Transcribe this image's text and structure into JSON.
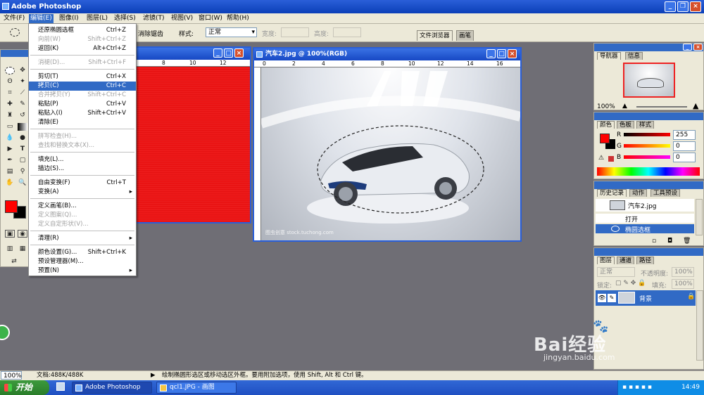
{
  "app": {
    "title": "Adobe Photoshop"
  },
  "menubar": [
    "文件(F)",
    "编辑(E)",
    "图像(I)",
    "图层(L)",
    "选择(S)",
    "滤镜(T)",
    "视图(V)",
    "窗口(W)",
    "帮助(H)"
  ],
  "options": {
    "feather_tail": "消除锯齿",
    "style_label": "样式:",
    "style_value": "正常",
    "width_label": "宽度:",
    "height_label": "高度:",
    "tab_file_browser": "文件浏览器",
    "tab_brushes": "画笔"
  },
  "edit_menu": {
    "items": [
      {
        "label": "还原椭圆选框",
        "shortcut": "Ctrl+Z",
        "disabled": false
      },
      {
        "label": "向前(W)",
        "shortcut": "Shift+Ctrl+Z",
        "disabled": true
      },
      {
        "label": "返回(K)",
        "shortcut": "Alt+Ctrl+Z",
        "disabled": false
      },
      {
        "label": "消褪(D)...",
        "shortcut": "Shift+Ctrl+F",
        "disabled": true
      },
      {
        "label": "剪切(T)",
        "shortcut": "Ctrl+X",
        "disabled": false
      },
      {
        "label": "拷贝(C)",
        "shortcut": "Ctrl+C",
        "disabled": false,
        "highlight": true
      },
      {
        "label": "合并拷贝(Y)",
        "shortcut": "Shift+Ctrl+C",
        "disabled": true
      },
      {
        "label": "粘贴(P)",
        "shortcut": "Ctrl+V",
        "disabled": false
      },
      {
        "label": "粘贴入(I)",
        "shortcut": "Shift+Ctrl+V",
        "disabled": false
      },
      {
        "label": "清除(E)",
        "shortcut": "",
        "disabled": false
      },
      {
        "label": "拼写检查(H)...",
        "shortcut": "",
        "disabled": true
      },
      {
        "label": "查找和替换文本(X)...",
        "shortcut": "",
        "disabled": true
      },
      {
        "label": "填充(L)...",
        "shortcut": "",
        "disabled": false
      },
      {
        "label": "描边(S)...",
        "shortcut": "",
        "disabled": false
      },
      {
        "label": "自由变换(F)",
        "shortcut": "Ctrl+T",
        "disabled": false
      },
      {
        "label": "变换(A)",
        "shortcut": "",
        "disabled": false,
        "submenu": true
      },
      {
        "label": "定义画笔(B)...",
        "shortcut": "",
        "disabled": false
      },
      {
        "label": "定义图案(Q)...",
        "shortcut": "",
        "disabled": true
      },
      {
        "label": "定义自定形状(V)...",
        "shortcut": "",
        "disabled": true
      },
      {
        "label": "清理(R)",
        "shortcut": "",
        "disabled": false,
        "submenu": true
      },
      {
        "label": "颜色设置(G)...",
        "shortcut": "Shift+Ctrl+K",
        "disabled": false
      },
      {
        "label": "预设管理器(M)...",
        "shortcut": "",
        "disabled": false
      },
      {
        "label": "预置(N)",
        "shortcut": "",
        "disabled": false,
        "submenu": true
      }
    ]
  },
  "doc_window": {
    "title": "汽车2.jpg @ 100%(RGB)",
    "ruler_labels": [
      "0",
      "2",
      "4",
      "6",
      "8",
      "10",
      "12",
      "14",
      "16"
    ],
    "watermark": "图虫创意 stock.tuchong.com"
  },
  "bg_window": {
    "ruler_labels": [
      "8",
      "10",
      "12"
    ]
  },
  "navigator": {
    "tabs": [
      "导航器",
      "信息"
    ],
    "zoom": "100%"
  },
  "color_panel": {
    "tabs": [
      "颜色",
      "色板",
      "样式"
    ],
    "channels": [
      {
        "name": "R",
        "value": "255"
      },
      {
        "name": "G",
        "value": "0"
      },
      {
        "name": "B",
        "value": "0"
      }
    ]
  },
  "history": {
    "tabs": [
      "历史记录",
      "动作",
      "工具预设"
    ],
    "snapshot": "汽车2.jpg",
    "steps": [
      "打开",
      "椭圆选框"
    ]
  },
  "layers": {
    "tabs": [
      "图层",
      "通道",
      "路径"
    ],
    "blend_mode": "正常",
    "opacity_label": "不透明度:",
    "opacity": "100%",
    "lock_label": "锁定:",
    "fill_label": "填充:",
    "fill": "100%",
    "layer_name": "背景"
  },
  "status": {
    "zoom": "100%",
    "doc_info": "文档:488K/488K",
    "hint": "绘制椭圆形选区或移动选区外框。要用附加选项，使用 Shift, Alt 和 Ctrl 键。"
  },
  "taskbar": {
    "start": "开始",
    "tasks": [
      "Adobe Photoshop",
      "qcl1.JPG - 画图"
    ],
    "clock": "14:49"
  },
  "watermark": {
    "brand": "Bai经验",
    "url": "jingyan.baidu.com"
  },
  "colors": {
    "foreground": "#ff0000",
    "accent": "#316ac5",
    "xp_blue": "#2a5fd8"
  }
}
